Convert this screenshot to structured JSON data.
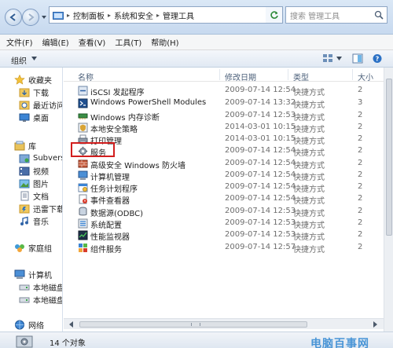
{
  "address": {
    "crumbs": [
      "控制面板",
      "系统和安全",
      "管理工具"
    ],
    "search_placeholder": "搜索 管理工具"
  },
  "menu": [
    "文件(F)",
    "编辑(E)",
    "查看(V)",
    "工具(T)",
    "帮助(H)"
  ],
  "toolbar": {
    "organize": "组织"
  },
  "columns": {
    "name": "名称",
    "date": "修改日期",
    "type": "类型",
    "size": "大小"
  },
  "nav": {
    "favorites": "收藏夹",
    "downloads": "下载",
    "recent": "最近访问",
    "desktop": "桌面",
    "libraries": "库",
    "subversion": "Subvers",
    "videos": "视频",
    "pictures": "图片",
    "documents": "文档",
    "xunlei": "迅雷下载",
    "music": "音乐",
    "homegroup": "家庭组",
    "computer": "计算机",
    "disk1": "本地磁盘",
    "disk2": "本地磁盘",
    "network": "网络"
  },
  "files": [
    {
      "name": "iSCSI 发起程序",
      "date": "2009-07-14 12:54",
      "type": "快捷方式",
      "size": "2"
    },
    {
      "name": "Windows PowerShell Modules",
      "date": "2009-07-14 13:32",
      "type": "快捷方式",
      "size": "3"
    },
    {
      "name": "Windows 内存诊断",
      "date": "2009-07-14 12:53",
      "type": "快捷方式",
      "size": "2"
    },
    {
      "name": "本地安全策略",
      "date": "2014-03-01 10:15",
      "type": "快捷方式",
      "size": "2"
    },
    {
      "name": "打印管理",
      "date": "2014-03-01 10:15",
      "type": "快捷方式",
      "size": "2"
    },
    {
      "name": "服务",
      "date": "2009-07-14 12:54",
      "type": "快捷方式",
      "size": "2"
    },
    {
      "name": "高级安全 Windows 防火墙",
      "date": "2009-07-14 12:54",
      "type": "快捷方式",
      "size": "2"
    },
    {
      "name": "计算机管理",
      "date": "2009-07-14 12:54",
      "type": "快捷方式",
      "size": "2"
    },
    {
      "name": "任务计划程序",
      "date": "2009-07-14 12:54",
      "type": "快捷方式",
      "size": "2"
    },
    {
      "name": "事件查看器",
      "date": "2009-07-14 12:54",
      "type": "快捷方式",
      "size": "2"
    },
    {
      "name": "数据源(ODBC)",
      "date": "2009-07-14 12:53",
      "type": "快捷方式",
      "size": "2"
    },
    {
      "name": "系统配置",
      "date": "2009-07-14 12:53",
      "type": "快捷方式",
      "size": "2"
    },
    {
      "name": "性能监视器",
      "date": "2009-07-14 12:53",
      "type": "快捷方式",
      "size": "2"
    },
    {
      "name": "组件服务",
      "date": "2009-07-14 12:57",
      "type": "快捷方式",
      "size": "2"
    }
  ],
  "status": {
    "count": "14 个对象"
  },
  "watermark": "电脑百事网",
  "colors": {
    "highlight": "#d21e1e",
    "accent": "#2e86d1"
  }
}
